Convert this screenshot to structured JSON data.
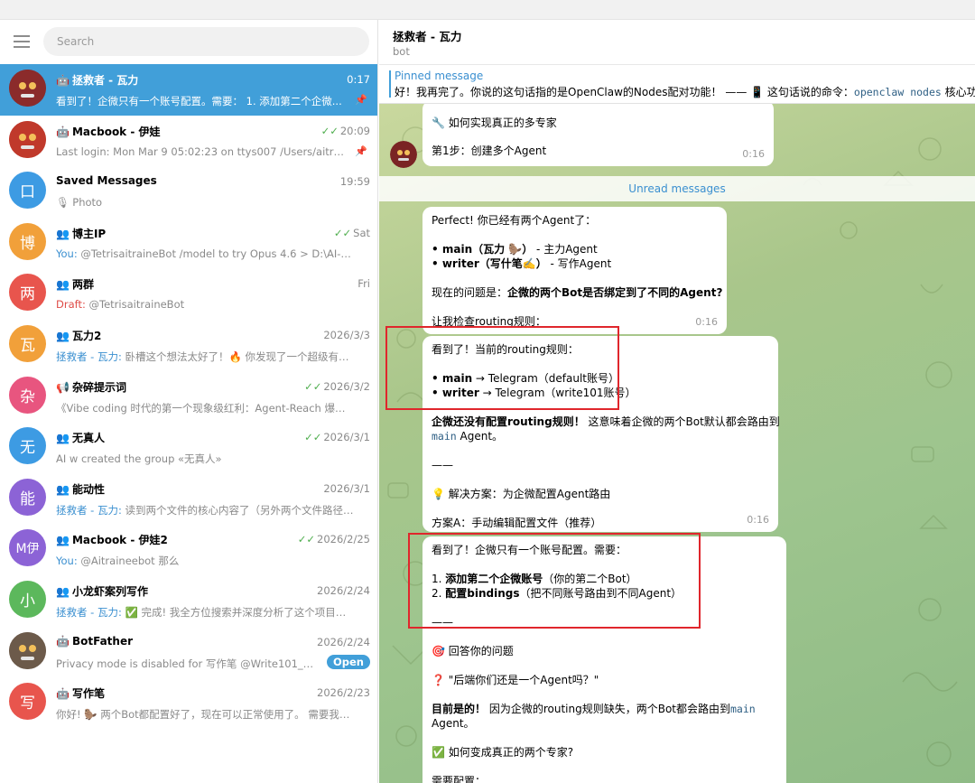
{
  "search": {
    "placeholder": "Search"
  },
  "chats": [
    {
      "name": "拯救者 - 瓦力",
      "type_icon": "🤖",
      "time": "0:17",
      "ticks": "",
      "sender": "",
      "preview": "看到了！企微只有一个账号配置。需要：  1. 添加第二个企微...",
      "pinned": true,
      "badge": "",
      "avatar_text": "",
      "avatar_color": "#8b2b2b"
    },
    {
      "name": "Macbook - 伊娃",
      "type_icon": "🤖",
      "time": "20:09",
      "ticks": "✓✓",
      "sender": "",
      "preview": "Last login: Mon Mar  9 05:02:23 on ttys007 /Users/aitraine...",
      "pinned": true,
      "badge": "",
      "avatar_text": "",
      "avatar_color": "#c0392b"
    },
    {
      "name": "Saved Messages",
      "type_icon": "",
      "time": "19:59",
      "ticks": "",
      "sender": "",
      "preview": "🎙 Photo",
      "pinned": false,
      "badge": "",
      "avatar_text": "口",
      "avatar_color": "#3d9be3"
    },
    {
      "name": "博主IP",
      "type_icon": "👥",
      "time": "Sat",
      "ticks": "✓✓",
      "sender": "You: ",
      "preview": "@TetrisaitraineBot    /model to try Opus 4.6 > D:\\AI-Code...",
      "pinned": false,
      "badge": "",
      "avatar_text": "博",
      "avatar_color": "#f1a03a"
    },
    {
      "name": "两群",
      "type_icon": "👥",
      "time": "Fri",
      "ticks": "",
      "sender": "Draft: ",
      "preview": "@TetrisaitraineBot",
      "pinned": false,
      "badge": "",
      "avatar_text": "两",
      "avatar_color": "#e8554d"
    },
    {
      "name": "瓦力2",
      "type_icon": "👥",
      "time": "2026/3/3",
      "ticks": "",
      "sender": "拯救者 - 瓦力: ",
      "preview": "卧槽这个想法太好了！🔥  你发现了一个超级有价...",
      "pinned": false,
      "badge": "",
      "avatar_text": "瓦",
      "avatar_color": "#f1a03a"
    },
    {
      "name": "杂碎提示词",
      "type_icon": "📢",
      "time": "2026/3/2",
      "ticks": "✓✓",
      "sender": "",
      "preview": "《Vibe coding 时代的第一个现象级红利：Agent-Reach 爆火背后...",
      "pinned": false,
      "badge": "",
      "avatar_text": "杂",
      "avatar_color": "#e8557f"
    },
    {
      "name": "无真人",
      "type_icon": "👥",
      "time": "2026/3/1",
      "ticks": "✓✓",
      "sender": "",
      "preview": "AI w created the group «无真人»",
      "pinned": false,
      "badge": "",
      "avatar_text": "无",
      "avatar_color": "#3d9be3"
    },
    {
      "name": "能动性",
      "type_icon": "👥",
      "time": "2026/3/1",
      "ticks": "",
      "sender": "拯救者 - 瓦力: ",
      "preview": "读到两个文件的核心内容了（另外两个文件路径不...",
      "pinned": false,
      "badge": "",
      "avatar_text": "能",
      "avatar_color": "#8c63d6"
    },
    {
      "name": "Macbook - 伊娃2",
      "type_icon": "👥",
      "time": "2026/2/25",
      "ticks": "✓✓",
      "sender": "You: ",
      "preview": "@Aitraineebot 那么",
      "pinned": false,
      "badge": "",
      "avatar_text": "M伊",
      "avatar_color": "#8c63d6"
    },
    {
      "name": "小龙虾案列写作",
      "type_icon": "👥",
      "time": "2026/2/24",
      "ticks": "",
      "sender": "拯救者 - 瓦力: ",
      "preview": "✅ 完成!   我全方位搜索并深度分析了这个项目，...",
      "pinned": false,
      "badge": "",
      "avatar_text": "小",
      "avatar_color": "#5cb85c"
    },
    {
      "name": "BotFather",
      "type_icon": "🤖",
      "time": "2026/2/24",
      "ticks": "",
      "sender": "",
      "preview": "Privacy mode is disabled for 写作笔 @Write101_bot.",
      "pinned": false,
      "badge": "Open",
      "avatar_text": "",
      "avatar_color": "#6c5a4a"
    },
    {
      "name": "写作笔",
      "type_icon": "🤖",
      "time": "2026/2/23",
      "ticks": "",
      "sender": "",
      "preview": "你好!   🦫  两个Bot都配置好了，现在可以正常使用了。  需要我帮...",
      "pinned": false,
      "badge": "",
      "avatar_text": "写",
      "avatar_color": "#e8554d"
    }
  ],
  "header": {
    "title": "拯救者 - 瓦力",
    "subtitle": "bot"
  },
  "pinned": {
    "label": "Pinned message",
    "text_before": "好！我再完了。你说的这句话指的是OpenClaw的Nodes配对功能！  —— 📱 这句话说的命令：",
    "code": "openclaw nodes",
    "text_after": " 核心功能"
  },
  "msg0": {
    "line1": "🔧 如何实现真正的多专家",
    "line2": "第1步：创建多个Agent",
    "time": "0:16"
  },
  "unread_label": "Unread messages",
  "msg1": {
    "l1": "Perfect! 你已经有两个Agent了：",
    "l2a": "• main（瓦力 🦫）",
    "l2b": "  - 主力Agent",
    "l3a": "• writer（写什笔✍️）",
    "l3b": "  - 写作Agent",
    "l4a": "现在的问题是：",
    "l4b": "企微的两个Bot是否绑定到了不同的Agent?",
    "l5": "让我检查routing规则：",
    "time": "0:16"
  },
  "msg2": {
    "l1": "看到了！当前的routing规则：",
    "l2a": "• main",
    "l2b": " → Telegram（default账号）",
    "l3a": "• writer",
    "l3b": " → Telegram（write101账号）",
    "l4a": "企微还没有配置routing规则！",
    "l4b": " 这意味着企微的两个Bot默认都会路由到",
    "l5code": "main",
    "l5b": " Agent。",
    "l6": "——",
    "l7": "💡 解决方案：为企微配置Agent路由",
    "l8": "方案A：手动编辑配置文件（推荐）",
    "time": "0:16"
  },
  "msg3": {
    "l1": "看到了！企微只有一个账号配置。需要：",
    "l2a": "1. ",
    "l2b": "添加第二个企微账号",
    "l2c": "（你的第二个Bot）",
    "l3a": "2. ",
    "l3b": "配置bindings",
    "l3c": "（把不同账号路由到不同Agent）",
    "l4": "——",
    "l5": "🎯 回答你的问题",
    "l6": "❓ \"后端你们还是一个Agent吗？\"",
    "l7a": "目前是的！",
    "l7b": " 因为企微的routing规则缺失，两个Bot都会路由到",
    "l7code": "main",
    "l8": "Agent。",
    "l9": "✅ 如何变成真正的两个专家?",
    "l10": "需要配置："
  },
  "colors": {
    "accent": "#419fd9",
    "highlight_box": "#e0262c",
    "check_green": "#4fae4e"
  }
}
